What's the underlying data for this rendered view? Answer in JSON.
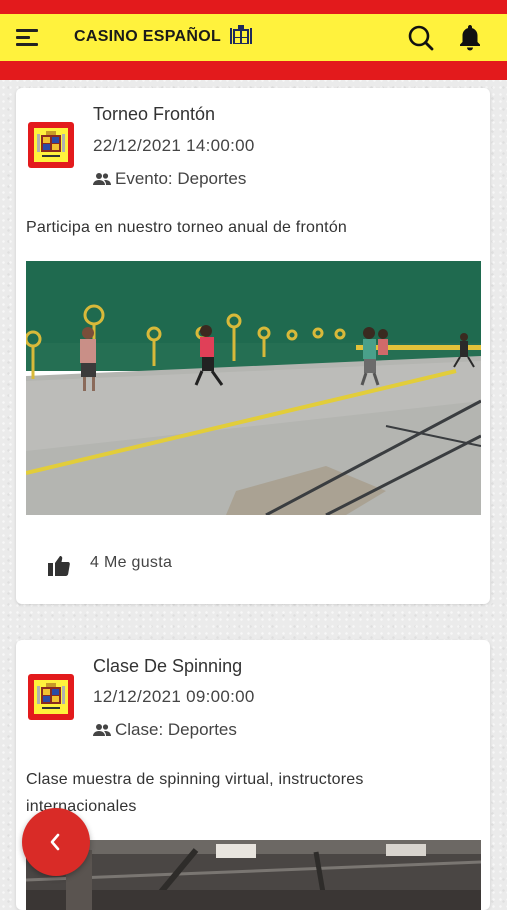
{
  "header": {
    "brand": "CASINO ESPAÑOL",
    "menu_icon": "hamburger-menu-icon",
    "search_icon": "search-icon",
    "bell_icon": "bell-icon",
    "colors": {
      "red": "#e31a1c",
      "yellow": "#fff23d"
    }
  },
  "posts": [
    {
      "title": "Torneo Frontón",
      "datetime": "22/12/2021  14:00:00",
      "category": "Evento: Deportes",
      "description": "Participa en nuestro torneo anual de frontón",
      "likes": "4 Me gusta"
    },
    {
      "title": "Clase De Spinning",
      "datetime": "12/12/2021  09:00:00",
      "category": "Clase: Deportes",
      "description": "Clase muestra de spinning virtual, instructores internacionales"
    }
  ],
  "fab": {
    "icon": "chevron-left-icon",
    "color": "#d92b27"
  }
}
